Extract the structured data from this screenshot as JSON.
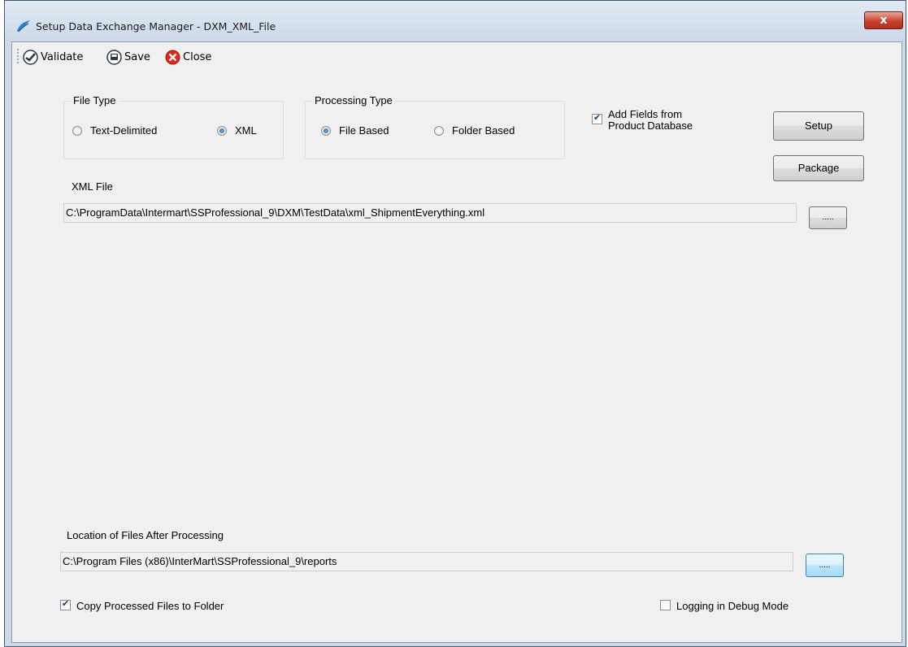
{
  "window": {
    "title": "Setup Data Exchange Manager - DXM_XML_File",
    "close_glyph": "x"
  },
  "toolbar": {
    "validate_label": "Validate",
    "save_label": "Save",
    "close_label": "Close"
  },
  "file_type": {
    "legend": "File Type",
    "options": [
      "Text-Delimited",
      "XML"
    ],
    "selected": "XML"
  },
  "processing_type": {
    "legend": "Processing Type",
    "options": [
      "File Based",
      "Folder Based"
    ],
    "selected": "File Based"
  },
  "add_fields": {
    "line1": "Add Fields from",
    "line2": "Product Database",
    "checked": true
  },
  "buttons": {
    "setup": "Setup",
    "package": "Package",
    "browse": "....."
  },
  "xml_file": {
    "label": "XML File",
    "value": "C:\\ProgramData\\Intermart\\SSProfessional_9\\DXM\\TestData\\xml_ShipmentEverything.xml"
  },
  "location": {
    "label": "Location of Files After Processing",
    "value": "C:\\Program Files (x86)\\InterMart\\SSProfessional_9\\reports"
  },
  "copy_processed": {
    "label": "Copy Processed Files to Folder",
    "checked": true
  },
  "logging_debug": {
    "label": "Logging in Debug Mode",
    "checked": false
  },
  "colors": {
    "accent": "#3c7fb1",
    "close_red": "#c8432f",
    "title_bg": "#cbd8e8"
  }
}
